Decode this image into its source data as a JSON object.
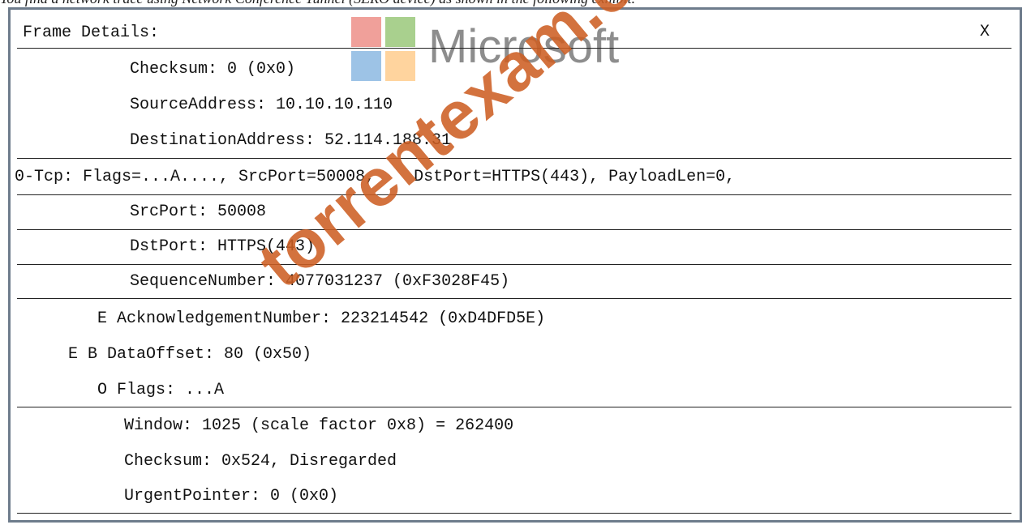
{
  "caption": "You find a network trace using Network Conference Tunnel (SERO device) as shown in the following exhibit.",
  "panel": {
    "title": "Frame Details:",
    "close_label": "X"
  },
  "rows": [
    "Checksum: 0 (0x0)",
    "SourceAddress: 10.10.10.110",
    "DestinationAddress: 52.114.188.31",
    "0-Tcp: Flags=...A...., SrcPort=50008,    DstPort=HTTPS(443), PayloadLen=0,",
    "SrcPort: 50008",
    "DstPort: HTTPS(443)",
    "SequenceNumber: 4077031237 (0xF3028F45)",
    "E AcknowledgementNumber: 223214542 (0xD4DFD5E)",
    "E B DataOffset: 80 (0x50)",
    "O Flags: ...A",
    "Window: 1025 (scale factor 0x8) = 262400",
    "Checksum: 0x524, Disregarded",
    "UrgentPointer: 0 (0x0)"
  ],
  "logo": {
    "text": "Microsoft",
    "colors": [
      "#f0a09a",
      "#a9d08e",
      "#9dc3e6",
      "#ffd49e"
    ]
  },
  "watermark": "torrentexam.com"
}
